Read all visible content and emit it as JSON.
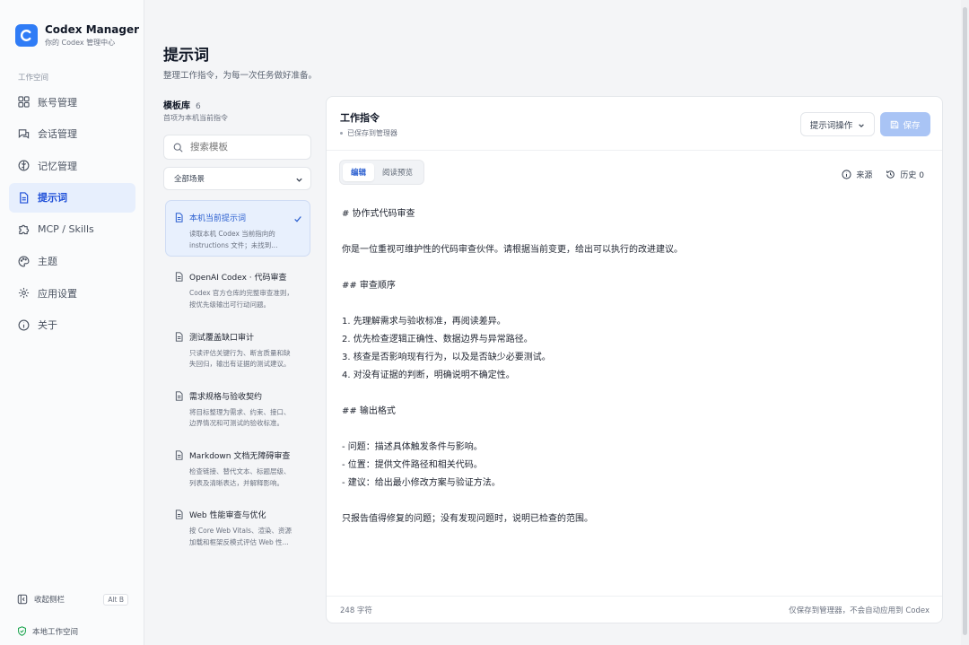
{
  "brand": {
    "title": "Codex Manager",
    "subtitle": "你的 Codex 管理中心"
  },
  "sidebar": {
    "section_label": "工作空间",
    "items": [
      {
        "label": "账号管理",
        "icon": "grid-icon"
      },
      {
        "label": "会话管理",
        "icon": "chat-icon"
      },
      {
        "label": "记忆管理",
        "icon": "brain-icon"
      },
      {
        "label": "提示词",
        "icon": "document-icon",
        "active": true
      },
      {
        "label": "MCP / Skills",
        "icon": "puzzle-icon"
      },
      {
        "label": "主题",
        "icon": "palette-icon"
      },
      {
        "label": "应用设置",
        "icon": "gear-icon"
      },
      {
        "label": "关于",
        "icon": "info-icon"
      }
    ],
    "collapse_label": "收起侧栏",
    "collapse_shortcut": "Alt B",
    "workspace_label": "本地工作空间"
  },
  "page": {
    "title": "提示词",
    "subtitle": "整理工作指令，为每一次任务做好准备。"
  },
  "templates": {
    "title": "模板库",
    "count": "6",
    "subtitle": "首项为本机当前指令",
    "search_placeholder": "搜索模板",
    "scene_select": "全部场景",
    "items": [
      {
        "name": "本机当前提示词",
        "desc1": "读取本机 Codex 当前指向的",
        "desc2": "instructions 文件；未找到...",
        "active": true
      },
      {
        "name": "OpenAI Codex · 代码审查",
        "desc1": "Codex 官方仓库的完整审查准则，",
        "desc2": "按优先级输出可行动问题。"
      },
      {
        "name": "测试覆盖缺口审计",
        "desc1": "只读评估关键行为、断言质量和缺",
        "desc2": "失回归，输出有证据的测试建议。"
      },
      {
        "name": "需求规格与验收契约",
        "desc1": "将目标整理为需求、约束、接口、",
        "desc2": "边界情况和可测试的验收标准。"
      },
      {
        "name": "Markdown 文档无障碍审查",
        "desc1": "检查链接、替代文本、标题层级、",
        "desc2": "列表及清晰表达，并解释影响。"
      },
      {
        "name": "Web 性能审查与优化",
        "desc1": "按 Core Web Vitals、渲染、资源",
        "desc2": "加载和框架反模式评估 Web 性..."
      }
    ]
  },
  "editor": {
    "title": "工作指令",
    "status": "已保存到管理器",
    "ops_label": "提示词操作",
    "save_label": "保存",
    "tabs": [
      "编辑",
      "阅读预览"
    ],
    "source_label": "来源",
    "history_label": "历史 0",
    "lines": [
      "# 协作式代码审查",
      "",
      "你是一位重视可维护性的代码审查伙伴。请根据当前变更，给出可以执行的改进建议。",
      "",
      "## 审查顺序",
      "",
      "1. 先理解需求与验收标准，再阅读差异。",
      "2. 优先检查逻辑正确性、数据边界与异常路径。",
      "3. 核查是否影响现有行为，以及是否缺少必要测试。",
      "4. 对没有证据的判断，明确说明不确定性。",
      "",
      "## 输出格式",
      "",
      "- 问题：描述具体触发条件与影响。",
      "- 位置：提供文件路径和相关代码。",
      "- 建议：给出最小修改方案与验证方法。",
      "",
      "只报告值得修复的问题；没有发现问题时，说明已检查的范围。"
    ],
    "char_count": "248 字符",
    "footer_note": "仅保存到管理器，不会自动应用到 Codex"
  },
  "colors": {
    "accent": "#2f7cf6",
    "active_bg": "#e7effd",
    "save_disabled": "#a9c4f5"
  }
}
